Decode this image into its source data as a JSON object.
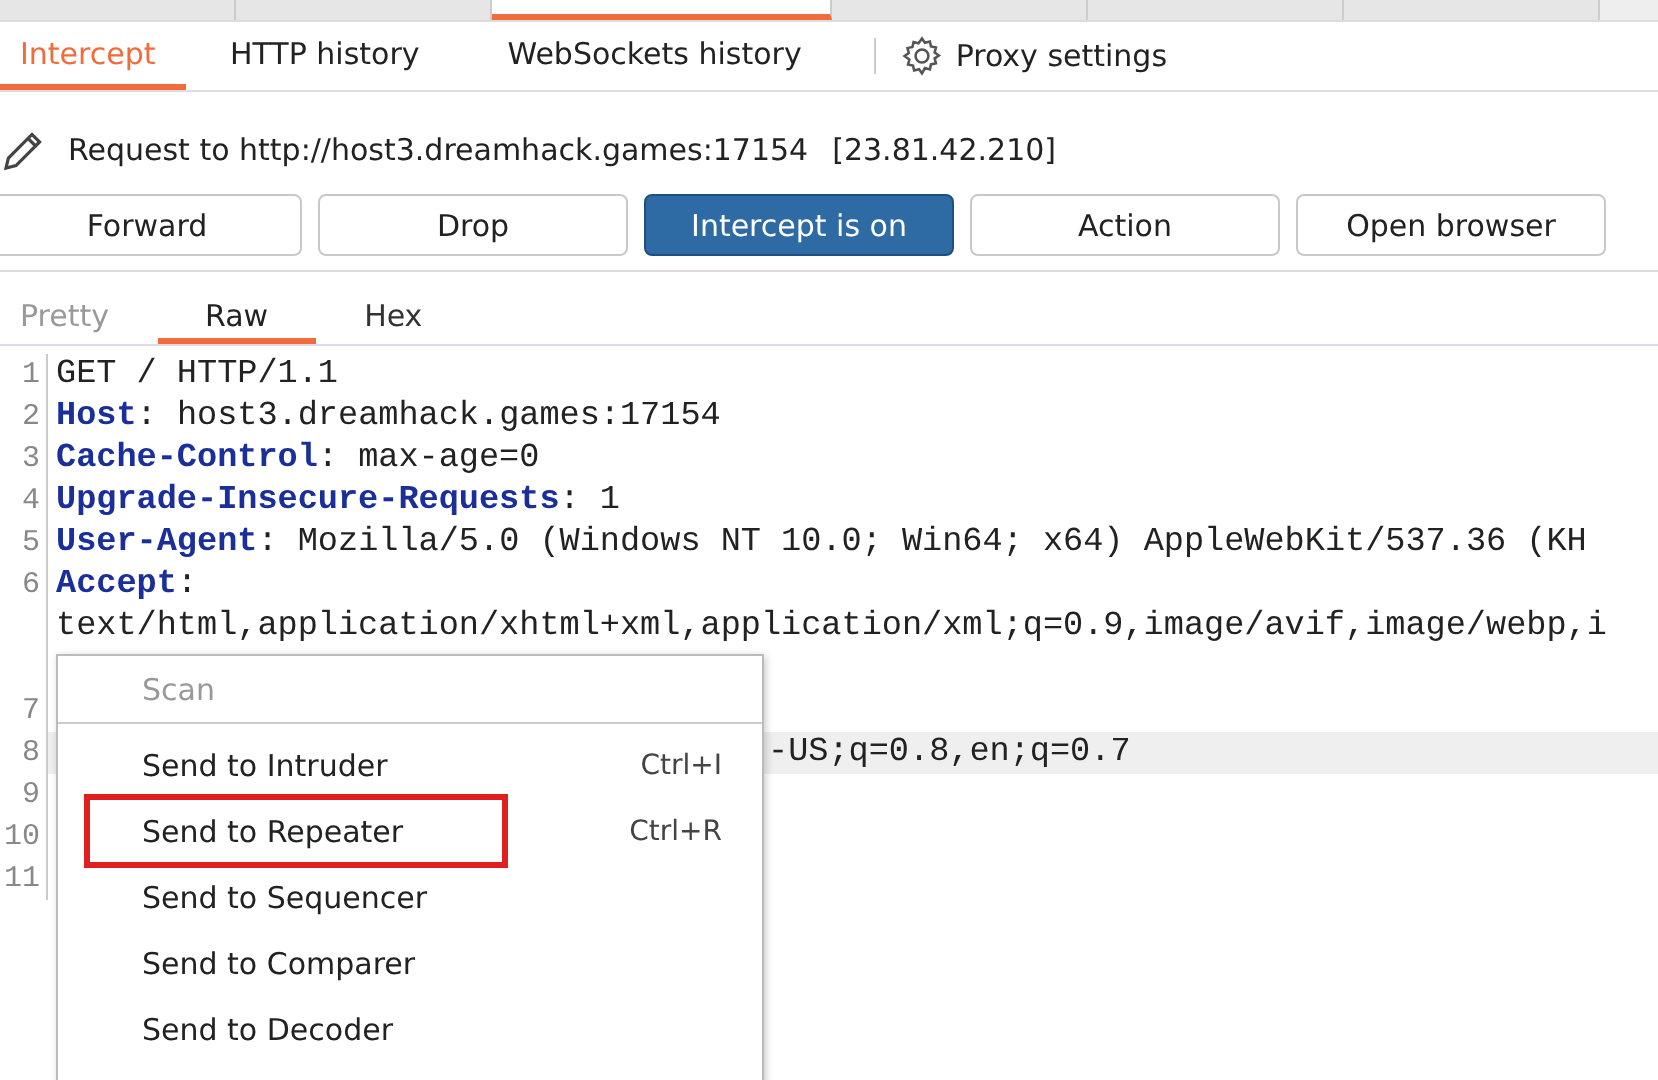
{
  "top_tabs": [
    {
      "selected": false
    },
    {
      "selected": false
    },
    {
      "selected": true
    },
    {
      "selected": false
    },
    {
      "selected": false
    },
    {
      "selected": false
    }
  ],
  "sub_tabs": [
    {
      "label": "Intercept",
      "selected": true
    },
    {
      "label": "HTTP history",
      "selected": false
    },
    {
      "label": "WebSockets history",
      "selected": false
    }
  ],
  "settings_link": "Proxy settings",
  "request_info": {
    "url": "Request to http://host3.dreamhack.games:17154",
    "ip": "[23.81.42.210]"
  },
  "buttons": [
    {
      "label": "Forward",
      "selected": false
    },
    {
      "label": "Drop",
      "selected": false
    },
    {
      "label": "Intercept is on",
      "selected": true
    },
    {
      "label": "Action",
      "selected": false
    },
    {
      "label": "Open browser",
      "selected": false
    }
  ],
  "editor_tabs": [
    {
      "label": "Pretty",
      "selected": false
    },
    {
      "label": "Raw",
      "selected": true
    },
    {
      "label": "Hex",
      "selected": false
    }
  ],
  "lines": [
    {
      "number": "1",
      "value": "GET / HTTP/1.1",
      "highlighted": false
    },
    {
      "number": "2",
      "header": "Host",
      "value": ": host3.dreamhack.games:17154",
      "highlighted": false
    },
    {
      "number": "3",
      "header": "Cache-Control",
      "value": ": max-age=0",
      "highlighted": false
    },
    {
      "number": "4",
      "header": "Upgrade-Insecure-Requests",
      "value": ": 1",
      "highlighted": false
    },
    {
      "number": "5",
      "header": "User-Agent",
      "value": ": Mozilla/5.0 (Windows NT 10.0; Win64; x64) AppleWebKit/537.36 (KH",
      "highlighted": false
    },
    {
      "number": "6",
      "header": "Accept",
      "value": ":",
      "highlighted": false
    },
    {
      "value": "text/html,application/xhtml+xml,application/xml;q=0.9,image/avif,image/webp,i",
      "highlighted": false
    },
    {
      "highlighted": false
    },
    {
      "number": "7",
      "highlighted": false
    },
    {
      "number": "8",
      "value": "-US;q=0.8,en;q=0.7",
      "highlighted": true,
      "covered": true
    },
    {
      "number": "9",
      "highlighted": false
    },
    {
      "number": "10",
      "highlighted": false
    },
    {
      "number": "11",
      "highlighted": false
    }
  ],
  "context_menu": [
    {
      "label": "Scan",
      "disabled": true,
      "outlined": false
    },
    {
      "label": "Send to Intruder",
      "shortcut": "Ctrl+I",
      "disabled": false,
      "outlined": false
    },
    {
      "label": "Send to Repeater",
      "shortcut": "Ctrl+R",
      "disabled": false,
      "outlined": true
    },
    {
      "label": "Send to Sequencer",
      "disabled": false,
      "outlined": false
    },
    {
      "label": "Send to Comparer",
      "disabled": false,
      "outlined": false
    },
    {
      "label": "Send to Decoder",
      "disabled": false,
      "outlined": false
    }
  ]
}
